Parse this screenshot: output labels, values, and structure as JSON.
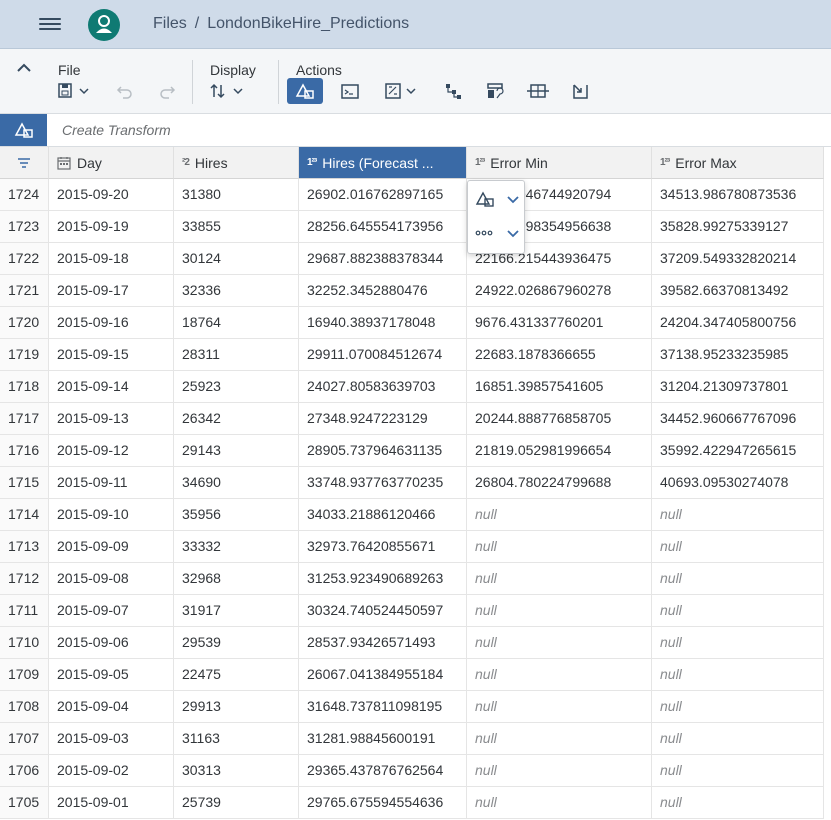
{
  "shell": {
    "breadcrumb": [
      "Files",
      "LondonBikeHire_Predictions"
    ],
    "separator": "/"
  },
  "toolbar": {
    "file_label": "File",
    "display_label": "Display",
    "actions_label": "Actions"
  },
  "transform": {
    "placeholder": "Create Transform"
  },
  "table": {
    "headers": [
      {
        "type_icon": "calendar-icon",
        "label": "Day"
      },
      {
        "type_icon": "integer-type-icon",
        "type_text": "²2",
        "label": "Hires"
      },
      {
        "type_icon": "decimal-type-icon",
        "type_text": "1²³",
        "label": "Hires (Forecast ..."
      },
      {
        "type_icon": "decimal-type-icon",
        "type_text": "1²³",
        "label": "Error Min"
      },
      {
        "type_icon": "decimal-type-icon",
        "type_text": "1²³",
        "label": "Error Max"
      }
    ],
    "rows": [
      [
        "1724",
        "2015-09-20",
        "31380",
        "26902.016762897165",
        "19290.046744920794",
        "34513.986780873536"
      ],
      [
        "1723",
        "2015-09-19",
        "33855",
        "28256.645554173956",
        "20684.298354956638",
        "35828.99275339127"
      ],
      [
        "1722",
        "2015-09-18",
        "30124",
        "29687.882388378344",
        "22166.215443936475",
        "37209.549332820214"
      ],
      [
        "1721",
        "2015-09-17",
        "32336",
        "32252.3452880476",
        "24922.026867960278",
        "39582.66370813492"
      ],
      [
        "1720",
        "2015-09-16",
        "18764",
        "16940.38937178048",
        "9676.431337760201",
        "24204.347405800756"
      ],
      [
        "1719",
        "2015-09-15",
        "28311",
        "29911.070084512674",
        "22683.1878366655",
        "37138.95233235985"
      ],
      [
        "1718",
        "2015-09-14",
        "25923",
        "24027.80583639703",
        "16851.39857541605",
        "31204.21309737801"
      ],
      [
        "1717",
        "2015-09-13",
        "26342",
        "27348.9247223129",
        "20244.888776858705",
        "34452.960667767096"
      ],
      [
        "1716",
        "2015-09-12",
        "29143",
        "28905.737964631135",
        "21819.052981996654",
        "35992.422947265615"
      ],
      [
        "1715",
        "2015-09-11",
        "34690",
        "33748.937763770235",
        "26804.780224799688",
        "40693.09530274078"
      ],
      [
        "1714",
        "2015-09-10",
        "35956",
        "34033.21886120466",
        "null",
        "null"
      ],
      [
        "1713",
        "2015-09-09",
        "33332",
        "32973.76420855671",
        "null",
        "null"
      ],
      [
        "1712",
        "2015-09-08",
        "32968",
        "31253.923490689263",
        "null",
        "null"
      ],
      [
        "1711",
        "2015-09-07",
        "31917",
        "30324.740524450597",
        "null",
        "null"
      ],
      [
        "1710",
        "2015-09-06",
        "29539",
        "28537.93426571493",
        "null",
        "null"
      ],
      [
        "1709",
        "2015-09-05",
        "22475",
        "26067.041384955184",
        "null",
        "null"
      ],
      [
        "1708",
        "2015-09-04",
        "29913",
        "31648.737811098195",
        "null",
        "null"
      ],
      [
        "1707",
        "2015-09-03",
        "31163",
        "31281.98845600191",
        "null",
        "null"
      ],
      [
        "1706",
        "2015-09-02",
        "30313",
        "29365.437876762564",
        "null",
        "null"
      ],
      [
        "1705",
        "2015-09-01",
        "25739",
        "29765.675594554636",
        "null",
        "null"
      ]
    ]
  },
  "colors": {
    "shellbar": "#cfdbe9",
    "accent": "#3a6aa6",
    "avatar": "#0f7a73"
  }
}
